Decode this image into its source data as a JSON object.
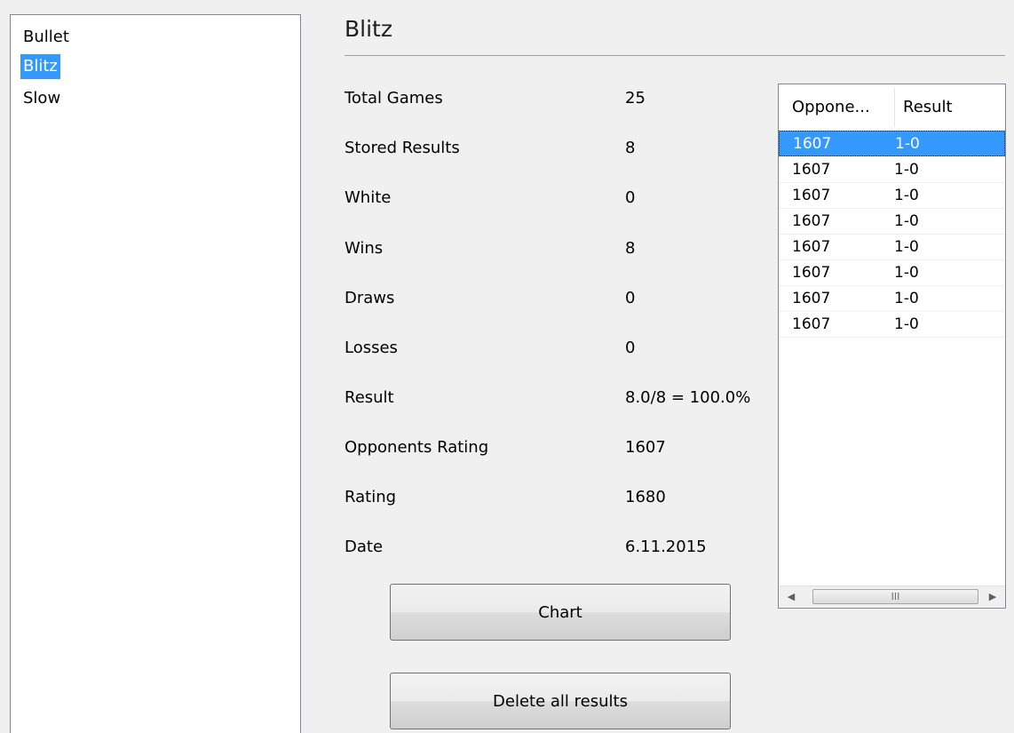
{
  "sidebar": {
    "items": [
      {
        "label": "Bullet"
      },
      {
        "label": "Blitz"
      },
      {
        "label": "Slow"
      }
    ],
    "selected_index": 1
  },
  "main": {
    "title": "Blitz",
    "stats": [
      {
        "label": "Total Games",
        "value": "25"
      },
      {
        "label": "Stored Results",
        "value": "8"
      },
      {
        "label": "White",
        "value": "0"
      },
      {
        "label": "Wins",
        "value": "8"
      },
      {
        "label": "Draws",
        "value": "0"
      },
      {
        "label": "Losses",
        "value": "0"
      },
      {
        "label": "Result",
        "value": "8.0/8 = 100.0%"
      },
      {
        "label": "Opponents Rating",
        "value": "1607"
      },
      {
        "label": "Rating",
        "value": "1680"
      },
      {
        "label": "Date",
        "value": "6.11.2015"
      }
    ],
    "buttons": {
      "chart_label": "Chart",
      "delete_label": "Delete all results"
    }
  },
  "results_table": {
    "columns": [
      "Oppone...",
      "Result"
    ],
    "rows": [
      {
        "opponent": "1607",
        "result": "1-0"
      },
      {
        "opponent": "1607",
        "result": "1-0"
      },
      {
        "opponent": "1607",
        "result": "1-0"
      },
      {
        "opponent": "1607",
        "result": "1-0"
      },
      {
        "opponent": "1607",
        "result": "1-0"
      },
      {
        "opponent": "1607",
        "result": "1-0"
      },
      {
        "opponent": "1607",
        "result": "1-0"
      },
      {
        "opponent": "1607",
        "result": "1-0"
      }
    ],
    "selected_row": 0,
    "scrollbar": {
      "left_icon": "scroll-left-arrow",
      "right_icon": "scroll-right-arrow",
      "thumb_grip": "III"
    }
  },
  "colors": {
    "selection": "#3399ff"
  }
}
